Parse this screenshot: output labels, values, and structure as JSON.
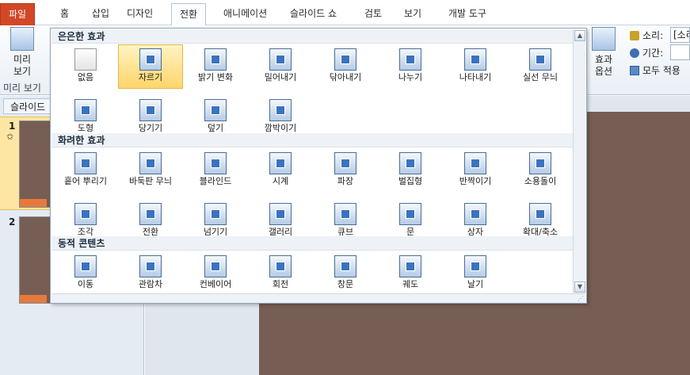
{
  "tabs": [
    {
      "label": "파일",
      "kind": "file"
    },
    {
      "label": "홈",
      "kind": ""
    },
    {
      "label": "삽입",
      "kind": ""
    },
    {
      "label": "디자인",
      "kind": ""
    },
    {
      "label": "전환",
      "kind": "active"
    },
    {
      "label": "애니메이션",
      "kind": ""
    },
    {
      "label": "슬라이드 쇼",
      "kind": ""
    },
    {
      "label": "검토",
      "kind": ""
    },
    {
      "label": "보기",
      "kind": ""
    },
    {
      "label": "개발 도구",
      "kind": ""
    }
  ],
  "ribbon": {
    "preview_label": "미리\n보기",
    "preview_group": "미리 보기",
    "effect_options_label": "효과\n옵션",
    "sound_label": "소리:",
    "sound_value": "[소리",
    "duration_label": "기간:",
    "apply_all_label": "모두 적용"
  },
  "slide_panel": {
    "tab_label": "슬라이드",
    "slides": [
      {
        "number": "1"
      },
      {
        "number": "2"
      }
    ]
  },
  "gallery": {
    "sections": [
      {
        "title": "은은한 효과",
        "items": [
          "없음",
          "자르기",
          "밝기 변화",
          "밀어내기",
          "닦아내기",
          "나누기",
          "나타내기",
          "실선 무늬",
          "도형",
          "당기기",
          "덮기",
          "깜박이기"
        ]
      },
      {
        "title": "화려한 효과",
        "items": [
          "흩어 뿌리기",
          "바둑판 무늬",
          "블라인드",
          "시계",
          "파장",
          "벌집형",
          "반짝이기",
          "소용돌이",
          "조각",
          "전환",
          "넘기기",
          "갤러리",
          "큐브",
          "문",
          "상자",
          "확대/축소"
        ]
      },
      {
        "title": "동적 콘텐츠",
        "items": [
          "이동",
          "관람차",
          "컨베이어",
          "회전",
          "창문",
          "궤도",
          "날기"
        ]
      }
    ],
    "selected_item": "자르기"
  },
  "colors": {
    "file_tab": "#d24726",
    "slide_background": "#765e54",
    "selection": "#ffd56b",
    "accent": "#e67a3c"
  }
}
